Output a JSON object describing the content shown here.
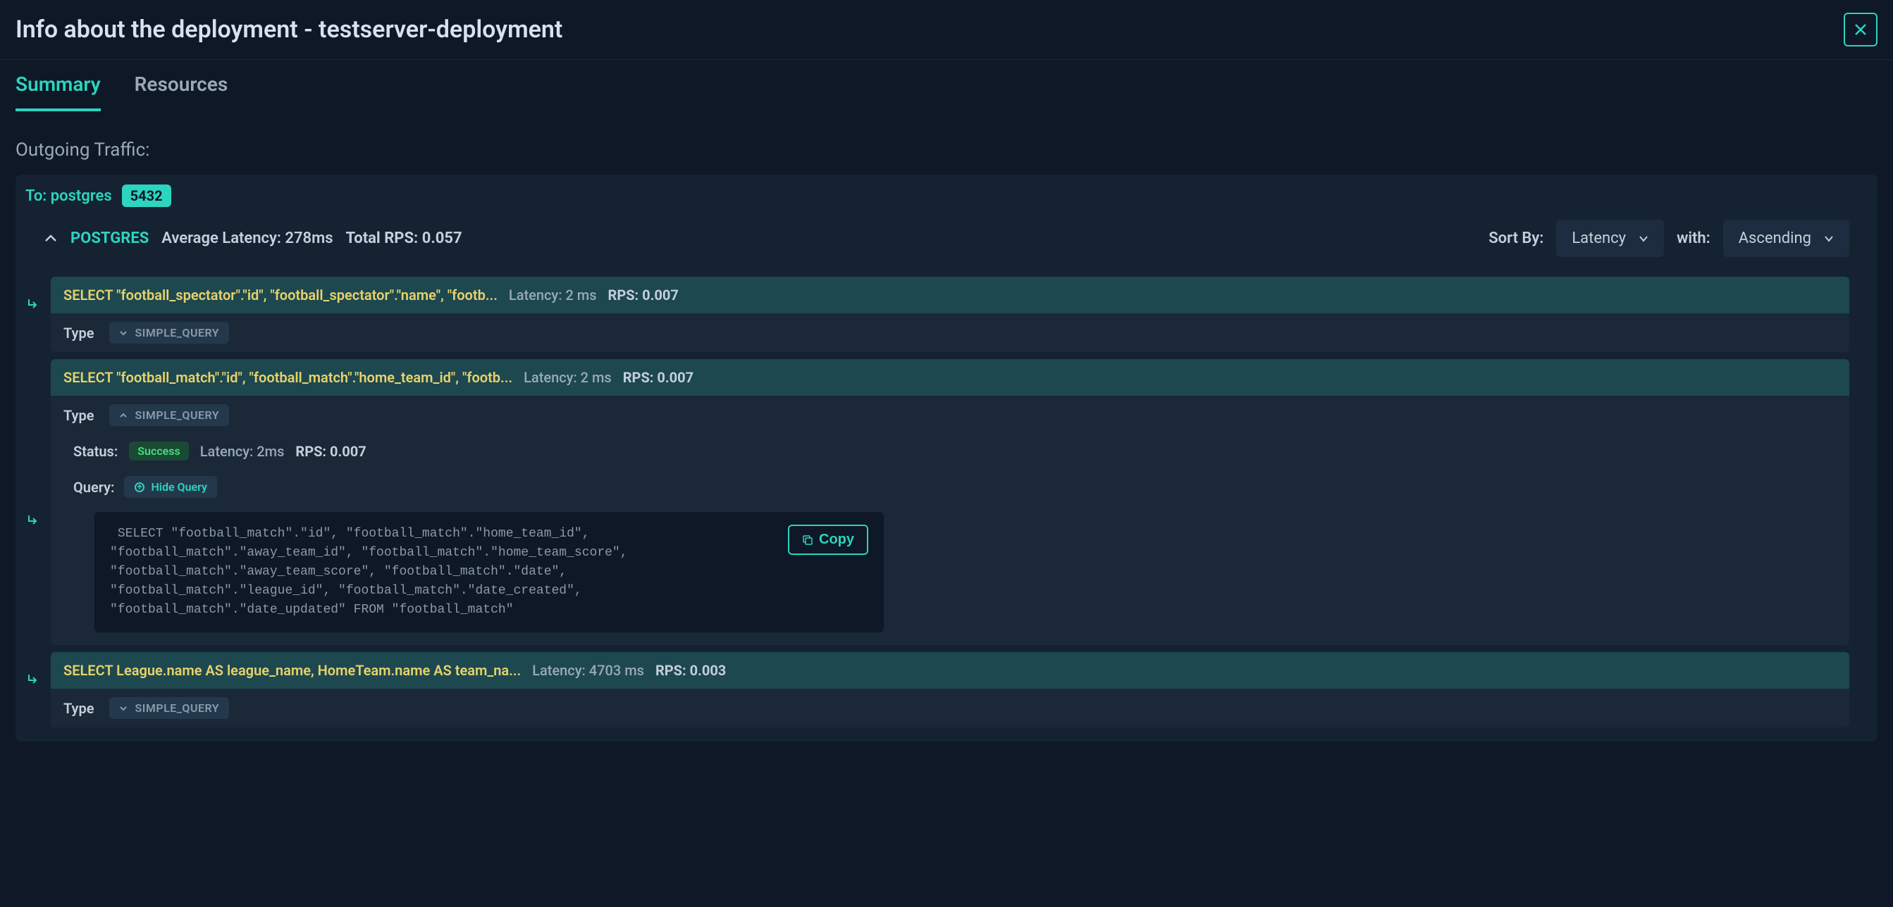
{
  "header": {
    "title": "Info about the deployment - testserver-deployment"
  },
  "tabs": {
    "summary": "Summary",
    "resources": "Resources"
  },
  "section": {
    "title": "Outgoing Traffic:"
  },
  "traffic": {
    "to_label": "To: postgres",
    "port": "5432",
    "protocol": "POSTGRES",
    "avg_latency": "Average Latency: 278ms",
    "total_rps": "Total RPS: 0.057",
    "sort_by_label": "Sort By:",
    "sort_by_value": "Latency",
    "with_label": "with:",
    "direction_value": "Ascending"
  },
  "queries": [
    {
      "sql": "SELECT \"football_spectator\".\"id\", \"football_spectator\".\"name\", \"footb...",
      "latency": "Latency: 2 ms",
      "rps": "RPS: 0.007",
      "type_label": "Type",
      "type_value": "SIMPLE_QUERY"
    },
    {
      "sql": "SELECT \"football_match\".\"id\", \"football_match\".\"home_team_id\", \"footb...",
      "latency": "Latency: 2 ms",
      "rps": "RPS: 0.007",
      "type_label": "Type",
      "type_value": "SIMPLE_QUERY",
      "status_label": "Status:",
      "status_value": "Success",
      "detail_latency": "Latency: 2ms",
      "detail_rps": "RPS: 0.007",
      "query_label": "Query:",
      "hide_query": "Hide Query",
      "full_query": " SELECT \"football_match\".\"id\", \"football_match\".\"home_team_id\",\n\"football_match\".\"away_team_id\", \"football_match\".\"home_team_score\",\n\"football_match\".\"away_team_score\", \"football_match\".\"date\",\n\"football_match\".\"league_id\", \"football_match\".\"date_created\",\n\"football_match\".\"date_updated\" FROM \"football_match\"",
      "copy_label": "Copy"
    },
    {
      "sql": "SELECT League.name AS league_name, HomeTeam.name AS team_na...",
      "latency": "Latency: 4703 ms",
      "rps": "RPS: 0.003",
      "type_label": "Type",
      "type_value": "SIMPLE_QUERY"
    }
  ]
}
